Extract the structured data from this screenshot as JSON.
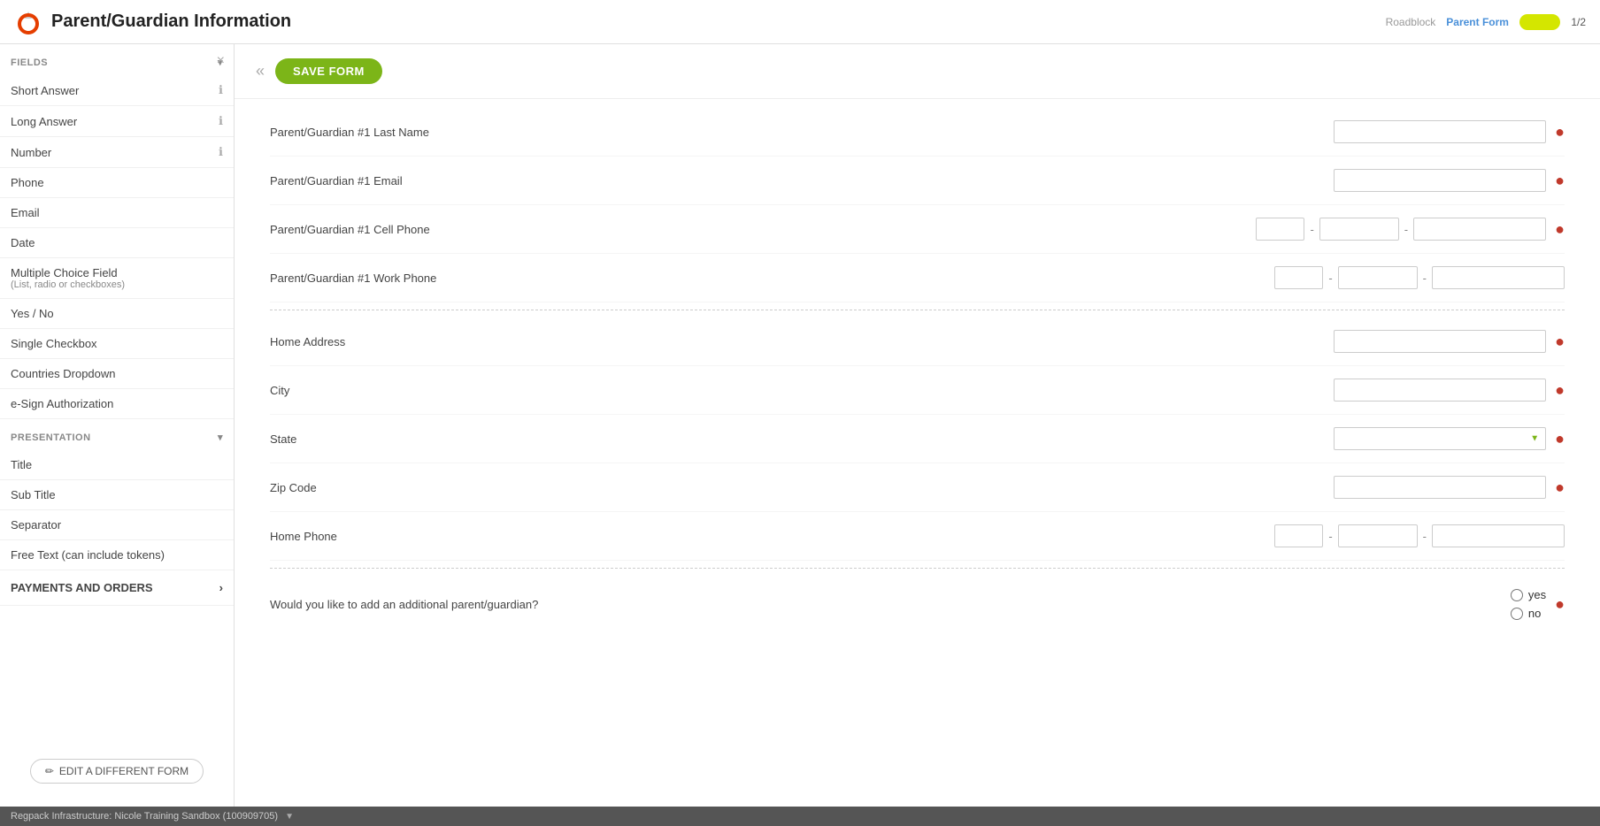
{
  "header": {
    "title": "Parent/Guardian Information",
    "roadblock_label": "Roadblock",
    "parent_form_label": "Parent Form",
    "page_count": "1/2"
  },
  "sidebar": {
    "close_icon": "×",
    "fields_section": "FIELDS",
    "fields_collapse_icon": "▾",
    "items": [
      {
        "label": "Short Answer",
        "has_info": true
      },
      {
        "label": "Long Answer",
        "has_info": true
      },
      {
        "label": "Number",
        "has_info": true
      },
      {
        "label": "Phone",
        "has_info": false
      },
      {
        "label": "Email",
        "has_info": false
      },
      {
        "label": "Date",
        "has_info": false
      },
      {
        "label": "Multiple Choice Field",
        "sub": "(List, radio or checkboxes)",
        "has_info": false
      },
      {
        "label": "Yes / No",
        "has_info": false
      },
      {
        "label": "Single Checkbox",
        "has_info": false
      },
      {
        "label": "Countries Dropdown",
        "has_info": false
      },
      {
        "label": "e-Sign Authorization",
        "has_info": false
      }
    ],
    "presentation_section": "PRESENTATION",
    "presentation_items": [
      {
        "label": "Title"
      },
      {
        "label": "Sub Title"
      },
      {
        "label": "Separator"
      },
      {
        "label": "Free Text (can include tokens)"
      }
    ],
    "payments_section": "PAYMENTS AND ORDERS",
    "edit_form_btn": "EDIT A DIFFERENT FORM",
    "pencil_icon": "✏"
  },
  "toolbar": {
    "back_label": "«",
    "save_label": "SAVE FORM"
  },
  "form": {
    "rows": [
      {
        "id": "last-name",
        "label": "Parent/Guardian #1 Last Name",
        "type": "text-wide",
        "required": true
      },
      {
        "id": "email",
        "label": "Parent/Guardian #1 Email",
        "type": "text-wide",
        "required": true
      },
      {
        "id": "cell-phone",
        "label": "Parent/Guardian #1 Cell Phone",
        "type": "phone",
        "required": true
      },
      {
        "id": "work-phone",
        "label": "Parent/Guardian #1 Work Phone",
        "type": "phone",
        "required": false
      }
    ],
    "divider1": true,
    "address_rows": [
      {
        "id": "home-address",
        "label": "Home Address",
        "type": "text-wide",
        "required": true
      },
      {
        "id": "city",
        "label": "City",
        "type": "text-wide",
        "required": true
      },
      {
        "id": "state",
        "label": "State",
        "type": "select",
        "required": true
      },
      {
        "id": "zip-code",
        "label": "Zip Code",
        "type": "text-wide",
        "required": true
      },
      {
        "id": "home-phone",
        "label": "Home Phone",
        "type": "phone",
        "required": false
      }
    ],
    "divider2": true,
    "additional_rows": [
      {
        "id": "additional-guardian",
        "label": "Would you like to add an additional parent/guardian?",
        "type": "yes-no",
        "required": true,
        "options": [
          "yes",
          "no"
        ]
      }
    ]
  },
  "status_bar": {
    "text": "Regpack Infrastructure: Nicole Training Sandbox (100909705)"
  }
}
